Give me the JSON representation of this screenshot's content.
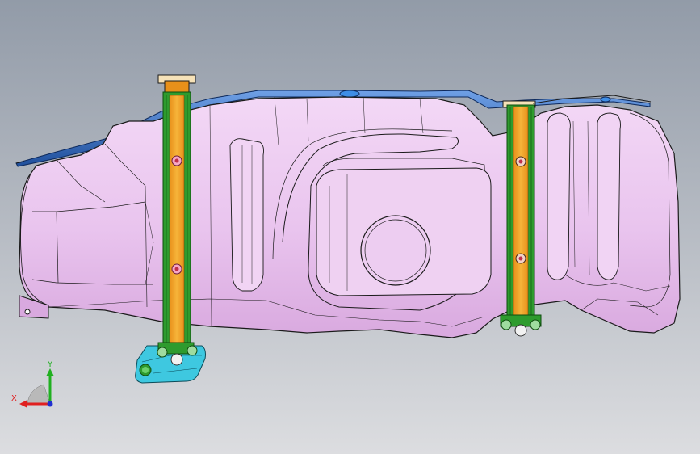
{
  "viewport": {
    "background_top": "#929ba8",
    "background_bottom": "#dcdde0"
  },
  "model": {
    "tank_color": "#eac6f0",
    "tank_edge_color": "#1a1a1a",
    "top_flange_color": "#2a5fb0",
    "strap_color": "#f0a020",
    "strap_border_color": "#2e9b2e",
    "bracket_color": "#3ec8e0"
  },
  "triad": {
    "x_label": "X",
    "y_label": "Y",
    "x_color": "#e02020",
    "y_color": "#20b020",
    "z_color": "#2030d0"
  }
}
